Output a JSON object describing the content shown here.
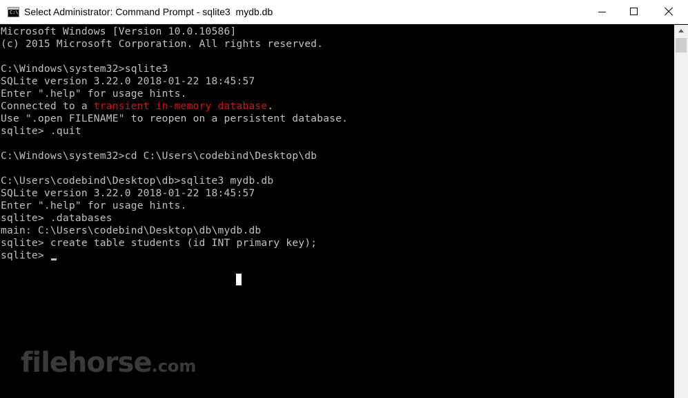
{
  "window": {
    "title": "Select Administrator: Command Prompt - sqlite3  mydb.db",
    "icon": "cmd-icon",
    "icon_text": "C:\\"
  },
  "controls": {
    "minimize": "minimize-icon",
    "maximize": "maximize-icon",
    "close": "close-icon"
  },
  "console": {
    "lines": [
      {
        "text": "Microsoft Windows [Version 10.0.10586]"
      },
      {
        "text": "(c) 2015 Microsoft Corporation. All rights reserved."
      },
      {
        "text": ""
      },
      {
        "text": "C:\\Windows\\system32>sqlite3"
      },
      {
        "text": "SQLite version 3.22.0 2018-01-22 18:45:57"
      },
      {
        "text": "Enter \".help\" for usage hints."
      },
      {
        "pre": "Connected to a ",
        "highlight": "transient in-memory database",
        "post": "."
      },
      {
        "text": "Use \".open FILENAME\" to reopen on a persistent database."
      },
      {
        "text": "sqlite> .quit"
      },
      {
        "text": ""
      },
      {
        "text": "C:\\Windows\\system32>cd C:\\Users\\codebind\\Desktop\\db"
      },
      {
        "text": ""
      },
      {
        "text": "C:\\Users\\codebind\\Desktop\\db>sqlite3 mydb.db"
      },
      {
        "text": "SQLite version 3.22.0 2018-01-22 18:45:57"
      },
      {
        "text": "Enter \".help\" for usage hints."
      },
      {
        "text": "sqlite> .databases"
      },
      {
        "text": "main: C:\\Users\\codebind\\Desktop\\db\\mydb.db"
      },
      {
        "text": "sqlite> create table students (id INT primary key);"
      },
      {
        "text": "sqlite> "
      }
    ],
    "colors": {
      "text": "#c0c0c0",
      "highlight": "#e01010",
      "background": "#000000"
    }
  },
  "watermark": {
    "main": "filehorse",
    "suffix": ".com"
  }
}
